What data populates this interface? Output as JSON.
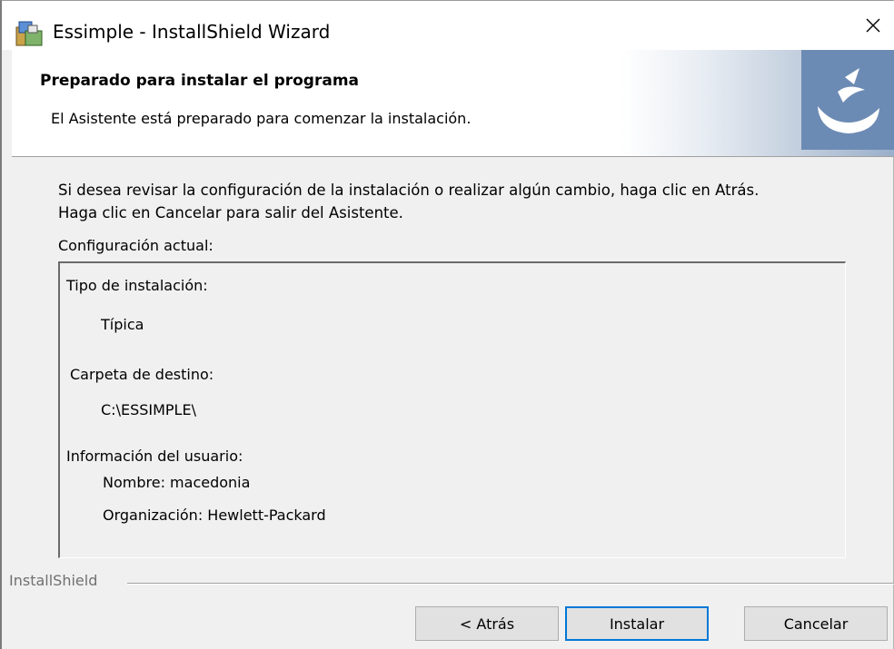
{
  "window": {
    "title": "Essimple - InstallShield Wizard"
  },
  "banner": {
    "title": "Preparado para instalar el programa",
    "subtitle": "El Asistente está preparado para comenzar la instalación."
  },
  "body": {
    "intro_line1": "Si desea revisar la configuración de la instalación o realizar algún cambio, haga clic en Atrás.",
    "intro_line2": "Haga clic en Cancelar para salir del Asistente.",
    "config_label": "Configuración actual:"
  },
  "config": {
    "install_type_label": "Tipo de instalación:",
    "install_type_value": "Típica",
    "destination_label": "Carpeta de destino:",
    "destination_value": "C:\\ESSIMPLE\\",
    "user_info_label": "Información del usuario:",
    "name_line": "Nombre: macedonia",
    "org_line": "Organización: Hewlett-Packard"
  },
  "footer": {
    "brand": "InstallShield"
  },
  "buttons": {
    "back": "< Atrás",
    "install": "Instalar",
    "cancel": "Cancelar"
  },
  "colors": {
    "accent": "#0078d7",
    "banner_logo": "#6c8bb4"
  }
}
